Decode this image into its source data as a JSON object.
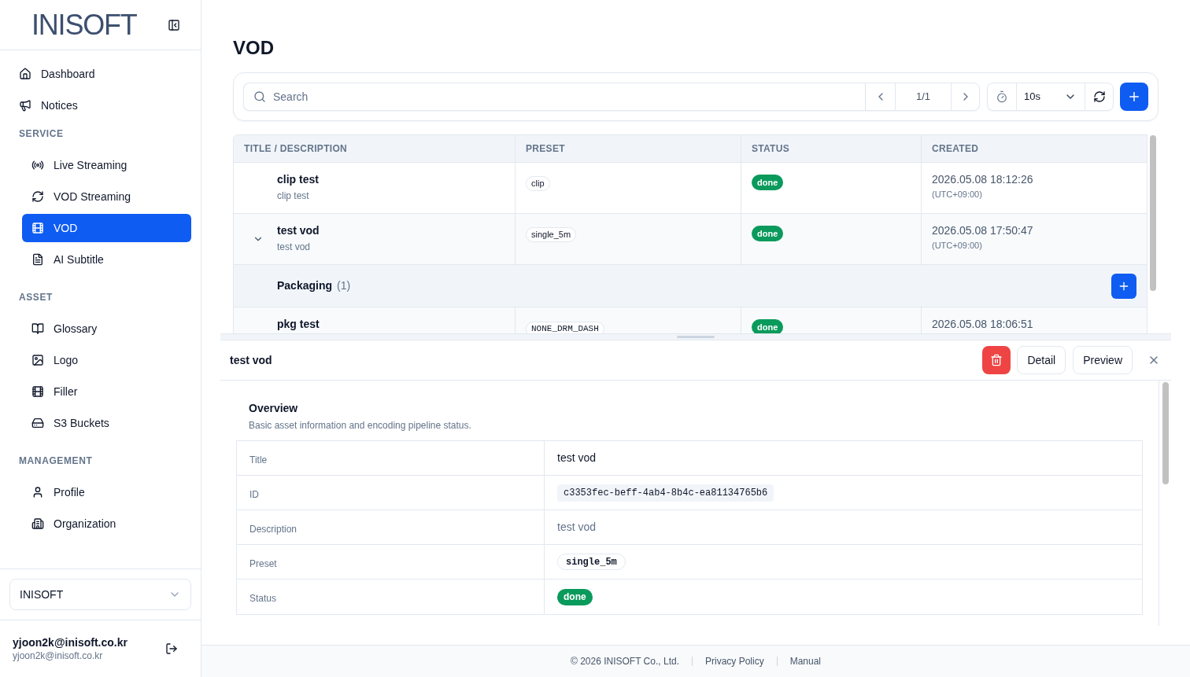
{
  "sidebar": {
    "logo": "INISOFT",
    "items": [
      {
        "label": "Dashboard",
        "selected": false
      },
      {
        "label": "Notices",
        "selected": false
      }
    ],
    "sections": [
      {
        "title": "SERVICE",
        "items": [
          {
            "label": "Live Streaming",
            "selected": false
          },
          {
            "label": "VOD Streaming",
            "selected": false
          },
          {
            "label": "VOD",
            "selected": true
          },
          {
            "label": "AI Subtitle",
            "selected": false
          }
        ]
      },
      {
        "title": "ASSET",
        "items": [
          {
            "label": "Glossary",
            "selected": false
          },
          {
            "label": "Logo",
            "selected": false
          },
          {
            "label": "Filler",
            "selected": false
          },
          {
            "label": "S3 Buckets",
            "selected": false
          }
        ]
      },
      {
        "title": "MANAGEMENT",
        "items": [
          {
            "label": "Profile",
            "selected": false
          },
          {
            "label": "Organization",
            "selected": false
          }
        ]
      }
    ],
    "organization_select": {
      "value": "INISOFT"
    },
    "user": {
      "name": "yjoon2k@inisoft.co.kr",
      "email": "yjoon2k@inisoft.co.kr"
    }
  },
  "page": {
    "title": "VOD"
  },
  "toolbar": {
    "search": {
      "placeholder": "Search"
    },
    "pagination": {
      "page": "1/1"
    },
    "refresh_interval": {
      "value": "10s"
    }
  },
  "table": {
    "columns": [
      "TITLE / DESCRIPTION",
      "PRESET",
      "STATUS",
      "CREATED"
    ],
    "rows": [
      {
        "title": "clip test",
        "description": "clip test",
        "preset": "clip",
        "status": "done",
        "created": "2026.05.08 18:12:26",
        "timezone": "(UTC+09:00)"
      },
      {
        "title": "test vod",
        "description": "test vod",
        "preset": "single_5m",
        "status": "done",
        "created": "2026.05.08 17:50:47",
        "timezone": "(UTC+09:00)",
        "expanded": true,
        "packaging": {
          "label": "Packaging",
          "count": "(1)",
          "rows": [
            {
              "title": "pkg test",
              "preset": "NONE_DRM_DASH",
              "status": "done",
              "created": "2026.05.08 18:06:51"
            }
          ]
        }
      }
    ]
  },
  "detail": {
    "title": "test vod",
    "actions": [
      "Detail",
      "Preview"
    ],
    "section": {
      "title": "Overview",
      "subtitle": "Basic asset information and encoding pipeline status."
    },
    "fields": [
      {
        "label": "Title",
        "value": "test vod",
        "kind": "text"
      },
      {
        "label": "ID",
        "value": "c3353fec-beff-4ab4-8b4c-ea81134765b6",
        "kind": "code"
      },
      {
        "label": "Description",
        "value": "test vod",
        "kind": "muted"
      },
      {
        "label": "Preset",
        "value": "single_5m",
        "kind": "tag"
      },
      {
        "label": "Status",
        "value": "done",
        "kind": "status"
      }
    ]
  },
  "footer": {
    "copyright": "© 2026 INISOFT Co., Ltd.",
    "links": [
      "Privacy Policy",
      "Manual"
    ]
  }
}
